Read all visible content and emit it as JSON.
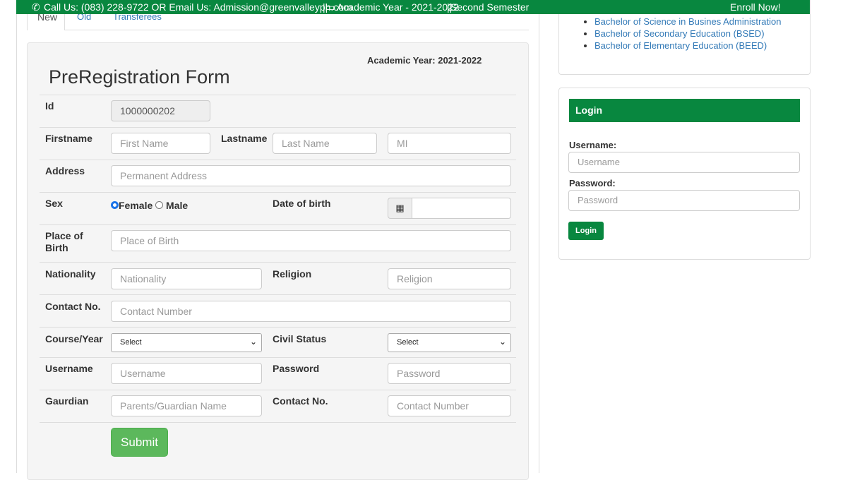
{
  "topbar": {
    "contact": "Call Us: (083) 228-9722 OR Email Us: Admission@greenvalleyph.com",
    "academic_year": "Academic Year - 2021-2022",
    "semester": "Second Semester",
    "enroll": "Enroll Now!",
    "accent": "#08873f"
  },
  "tabs": [
    {
      "label": "New"
    },
    {
      "label": "Old"
    },
    {
      "label": "Transferees"
    }
  ],
  "form": {
    "academic_year": "Academic Year: 2021-2022",
    "title": "PreRegistration Form",
    "id_label": "Id",
    "id_value": "1000000202",
    "firstname_label": "Firstname",
    "firstname_ph": "First Name",
    "lastname_label": "Lastname",
    "lastname_ph": "Last Name",
    "mi_ph": "MI",
    "address_label": "Address",
    "address_ph": "Permanent Address",
    "sex_label": "Sex",
    "female": "Female",
    "male": "Male",
    "sex_selected": "Female",
    "dob_label": "Date of birth",
    "pob_label": "Place of Birth",
    "pob_ph": "Place of Birth",
    "nationality_label": "Nationality",
    "nationality_ph": "Nationality",
    "religion_label": "Religion",
    "religion_ph": "Religion",
    "contact_label": "Contact No.",
    "contact_ph": "Contact Number",
    "course_label": "Course/Year",
    "course_value": "Select",
    "civil_label": "Civil Status",
    "civil_value": "Select",
    "username_label": "Username",
    "username_ph": "Username",
    "password_label": "Password",
    "password_ph": "Password",
    "guardian_label": "Gaurdian",
    "guardian_ph": "Parents/Guardian Name",
    "gcontact_label": "Contact No.",
    "gcontact_ph": "Contact Number",
    "submit": "Submit"
  },
  "courses": [
    "Bachelor of Science in Busines Administration",
    "Bachelor of Secondary Education (BSED)",
    "Bachelor of Elementary Education (BEED)"
  ],
  "login": {
    "title": "Login",
    "username_label": "Username:",
    "username_ph": "Username",
    "password_label": "Password:",
    "password_ph": "Password",
    "button": "Login"
  }
}
